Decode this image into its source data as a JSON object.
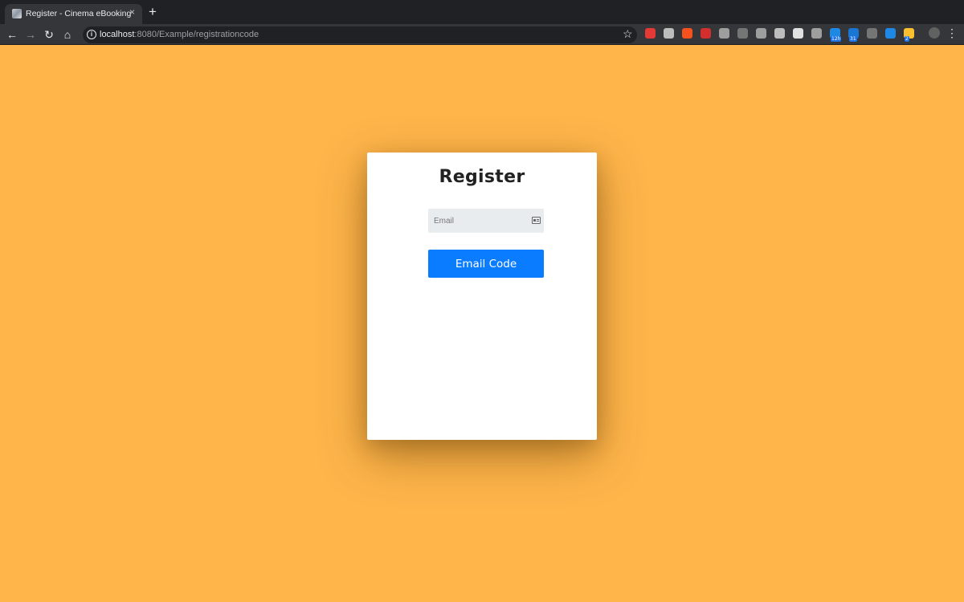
{
  "browser": {
    "tab": {
      "title": "Register - Cinema eBooking",
      "close_glyph": "×"
    },
    "new_tab_glyph": "+",
    "nav": {
      "back_glyph": "←",
      "forward_glyph": "→",
      "reload_glyph": "↻",
      "home_glyph": "⌂"
    },
    "address": {
      "host": "localhost",
      "path": ":8080/Example/registrationcode"
    },
    "bookmark_glyph": "☆",
    "menu_glyph": "⋮",
    "extensions": [
      {
        "name": "ext-red-icon",
        "color": "#e53935"
      },
      {
        "name": "ext-drive-icon",
        "color": "#bdbdbd"
      },
      {
        "name": "ext-orange-icon",
        "color": "#f4511e"
      },
      {
        "name": "ext-youtube-icon",
        "color": "#d32f2f"
      },
      {
        "name": "ext-stack-icon",
        "color": "#9e9e9e"
      },
      {
        "name": "ext-screen-icon",
        "color": "#757575"
      },
      {
        "name": "ext-cursor-icon",
        "color": "#9e9e9e"
      },
      {
        "name": "ext-grey-icon",
        "color": "#bdbdbd"
      },
      {
        "name": "ext-laptop-icon",
        "color": "#e0e0e0"
      },
      {
        "name": "ext-os-icon",
        "color": "#9e9e9e"
      },
      {
        "name": "ext-blue-icon",
        "color": "#1e88e5",
        "badge": "12h"
      },
      {
        "name": "ext-calendar-icon",
        "color": "#1976d2",
        "badge": "31"
      },
      {
        "name": "ext-glasses-icon",
        "color": "#757575"
      },
      {
        "name": "ext-bird-icon",
        "color": "#1e88e5"
      },
      {
        "name": "ext-note-icon",
        "color": "#fbc02d",
        "badge": "2"
      },
      {
        "name": "profile-avatar-icon",
        "color": "#616161"
      }
    ]
  },
  "page": {
    "background": "#FFB54A",
    "title": "Register",
    "email": {
      "placeholder": "Email",
      "value": ""
    },
    "submit_label": "Email Code",
    "accent": "#0a7cff"
  }
}
